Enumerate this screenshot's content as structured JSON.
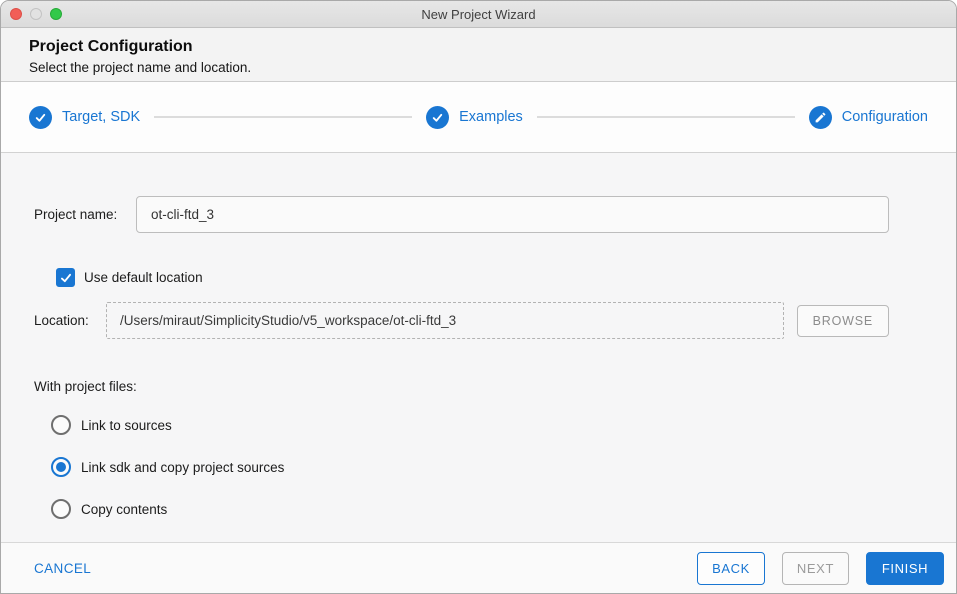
{
  "window": {
    "title": "New Project Wizard"
  },
  "header": {
    "title": "Project Configuration",
    "subtitle": "Select the project name and location."
  },
  "stepper": {
    "steps": [
      {
        "label": "Target, SDK",
        "icon": "check-icon",
        "state": "completed"
      },
      {
        "label": "Examples",
        "icon": "check-icon",
        "state": "completed"
      },
      {
        "label": "Configuration",
        "icon": "pencil-icon",
        "state": "current"
      }
    ]
  },
  "form": {
    "project_name": {
      "label": "Project name:",
      "value": "ot-cli-ftd_3"
    },
    "use_default_location": {
      "label": "Use default location",
      "checked": true
    },
    "location": {
      "label": "Location:",
      "value": "/Users/miraut/SimplicityStudio/v5_workspace/ot-cli-ftd_3",
      "browse_label": "BROWSE",
      "disabled": true
    },
    "with_project_files": {
      "label": "With project files:",
      "options": [
        {
          "label": "Link to sources",
          "selected": false
        },
        {
          "label": "Link sdk and copy project sources",
          "selected": true
        },
        {
          "label": "Copy contents",
          "selected": false
        }
      ]
    }
  },
  "footer": {
    "cancel_label": "CANCEL",
    "back_label": "BACK",
    "next_label": "NEXT",
    "finish_label": "FINISH",
    "next_enabled": false
  },
  "colors": {
    "accent": "#1976d2",
    "traffic_close": "#f25e57",
    "traffic_minimize": "#e2e2e2",
    "traffic_zoom": "#32c949"
  }
}
